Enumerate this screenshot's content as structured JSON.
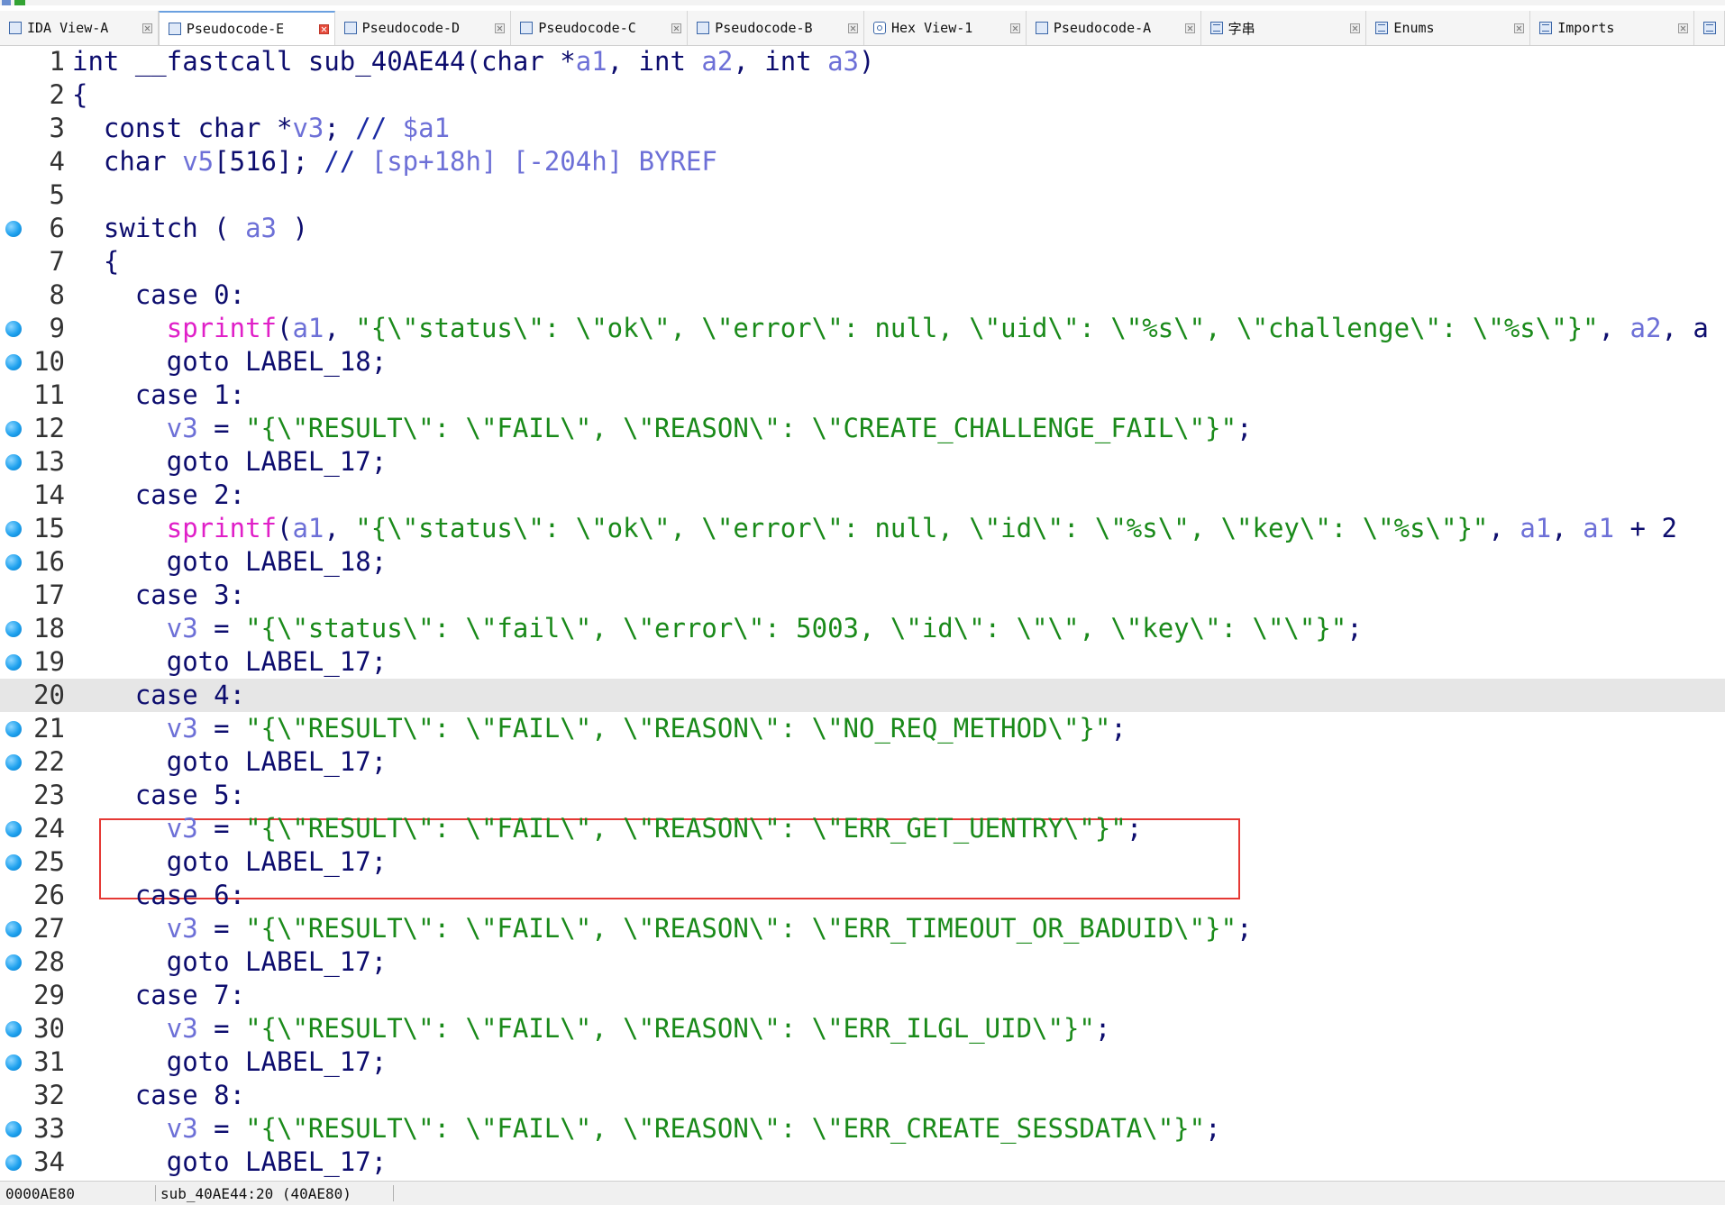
{
  "tabs": [
    {
      "label": "IDA View-A",
      "icon": "doc-icon",
      "active": false
    },
    {
      "label": "Pseudocode-E",
      "icon": "doc-icon",
      "active": true
    },
    {
      "label": "Pseudocode-D",
      "icon": "doc-icon",
      "active": false
    },
    {
      "label": "Pseudocode-C",
      "icon": "doc-icon",
      "active": false
    },
    {
      "label": "Pseudocode-B",
      "icon": "doc-icon",
      "active": false
    },
    {
      "label": "Hex View-1",
      "icon": "hex-icon",
      "active": false
    },
    {
      "label": "Pseudocode-A",
      "icon": "doc-icon",
      "active": false
    },
    {
      "label": "字串",
      "icon": "strings-icon",
      "active": false
    },
    {
      "label": "Enums",
      "icon": "enums-icon",
      "active": false
    },
    {
      "label": "Imports",
      "icon": "imports-icon",
      "active": false
    }
  ],
  "colors": {
    "keyword": "#0d0d6e",
    "variable": "#6d70d7",
    "function": "#e020c8",
    "string": "#1a8a1a",
    "comment": "#1a2aa3",
    "highlight_box": "#e53935",
    "breakpoint": "#1ea1ee",
    "current_line_bg": "#e6e6e6"
  },
  "code": {
    "current_line": 20,
    "lines": [
      {
        "n": "1",
        "bp": false,
        "text": "int __fastcall sub_40AE44(char *a1, int a2, int a3)"
      },
      {
        "n": "2",
        "bp": false,
        "text": "{"
      },
      {
        "n": "3",
        "bp": false,
        "text": "  const char *v3; // $a1"
      },
      {
        "n": "4",
        "bp": false,
        "text": "  char v5[516]; // [sp+18h] [-204h] BYREF"
      },
      {
        "n": "5",
        "bp": false,
        "text": ""
      },
      {
        "n": "6",
        "bp": true,
        "text": "  switch ( a3 )"
      },
      {
        "n": "7",
        "bp": false,
        "text": "  {"
      },
      {
        "n": "8",
        "bp": false,
        "text": "    case 0:"
      },
      {
        "n": "9",
        "bp": true,
        "text": "      sprintf(a1, \"{\\\"status\\\": \\\"ok\\\", \\\"error\\\": null, \\\"uid\\\": \\\"%s\\\", \\\"challenge\\\": \\\"%s\\\"}\", a2, a"
      },
      {
        "n": "10",
        "bp": true,
        "text": "      goto LABEL_18;"
      },
      {
        "n": "11",
        "bp": false,
        "text": "    case 1:"
      },
      {
        "n": "12",
        "bp": true,
        "text": "      v3 = \"{\\\"RESULT\\\": \\\"FAIL\\\", \\\"REASON\\\": \\\"CREATE_CHALLENGE_FAIL\\\"}\";"
      },
      {
        "n": "13",
        "bp": true,
        "text": "      goto LABEL_17;"
      },
      {
        "n": "14",
        "bp": false,
        "text": "    case 2:"
      },
      {
        "n": "15",
        "bp": true,
        "text": "      sprintf(a1, \"{\\\"status\\\": \\\"ok\\\", \\\"error\\\": null, \\\"id\\\": \\\"%s\\\", \\\"key\\\": \\\"%s\\\"}\", a1, a1 + 2"
      },
      {
        "n": "16",
        "bp": true,
        "text": "      goto LABEL_18;"
      },
      {
        "n": "17",
        "bp": false,
        "text": "    case 3:"
      },
      {
        "n": "18",
        "bp": true,
        "text": "      v3 = \"{\\\"status\\\": \\\"fail\\\", \\\"error\\\": 5003, \\\"id\\\": \\\"\\\", \\\"key\\\": \\\"\\\"}\";"
      },
      {
        "n": "19",
        "bp": true,
        "text": "      goto LABEL_17;"
      },
      {
        "n": "20",
        "bp": false,
        "text": "    case 4:"
      },
      {
        "n": "21",
        "bp": true,
        "text": "      v3 = \"{\\\"RESULT\\\": \\\"FAIL\\\", \\\"REASON\\\": \\\"NO_REQ_METHOD\\\"}\";"
      },
      {
        "n": "22",
        "bp": true,
        "text": "      goto LABEL_17;"
      },
      {
        "n": "23",
        "bp": false,
        "text": "    case 5:"
      },
      {
        "n": "24",
        "bp": true,
        "text": "      v3 = \"{\\\"RESULT\\\": \\\"FAIL\\\", \\\"REASON\\\": \\\"ERR_GET_UENTRY\\\"}\";"
      },
      {
        "n": "25",
        "bp": true,
        "text": "      goto LABEL_17;"
      },
      {
        "n": "26",
        "bp": false,
        "text": "    case 6:"
      },
      {
        "n": "27",
        "bp": true,
        "text": "      v3 = \"{\\\"RESULT\\\": \\\"FAIL\\\", \\\"REASON\\\": \\\"ERR_TIMEOUT_OR_BADUID\\\"}\";"
      },
      {
        "n": "28",
        "bp": true,
        "text": "      goto LABEL_17;"
      },
      {
        "n": "29",
        "bp": false,
        "text": "    case 7:"
      },
      {
        "n": "30",
        "bp": true,
        "text": "      v3 = \"{\\\"RESULT\\\": \\\"FAIL\\\", \\\"REASON\\\": \\\"ERR_ILGL_UID\\\"}\";"
      },
      {
        "n": "31",
        "bp": true,
        "text": "      goto LABEL_17;"
      },
      {
        "n": "32",
        "bp": false,
        "text": "    case 8:"
      },
      {
        "n": "33",
        "bp": true,
        "text": "      v3 = \"{\\\"RESULT\\\": \\\"FAIL\\\", \\\"REASON\\\": \\\"ERR_CREATE_SESSDATA\\\"}\";"
      },
      {
        "n": "34",
        "bp": true,
        "text": "      goto LABEL_17;"
      }
    ]
  },
  "statusbar": {
    "address": "0000AE80",
    "location": "sub_40AE44:20 (40AE80)"
  }
}
